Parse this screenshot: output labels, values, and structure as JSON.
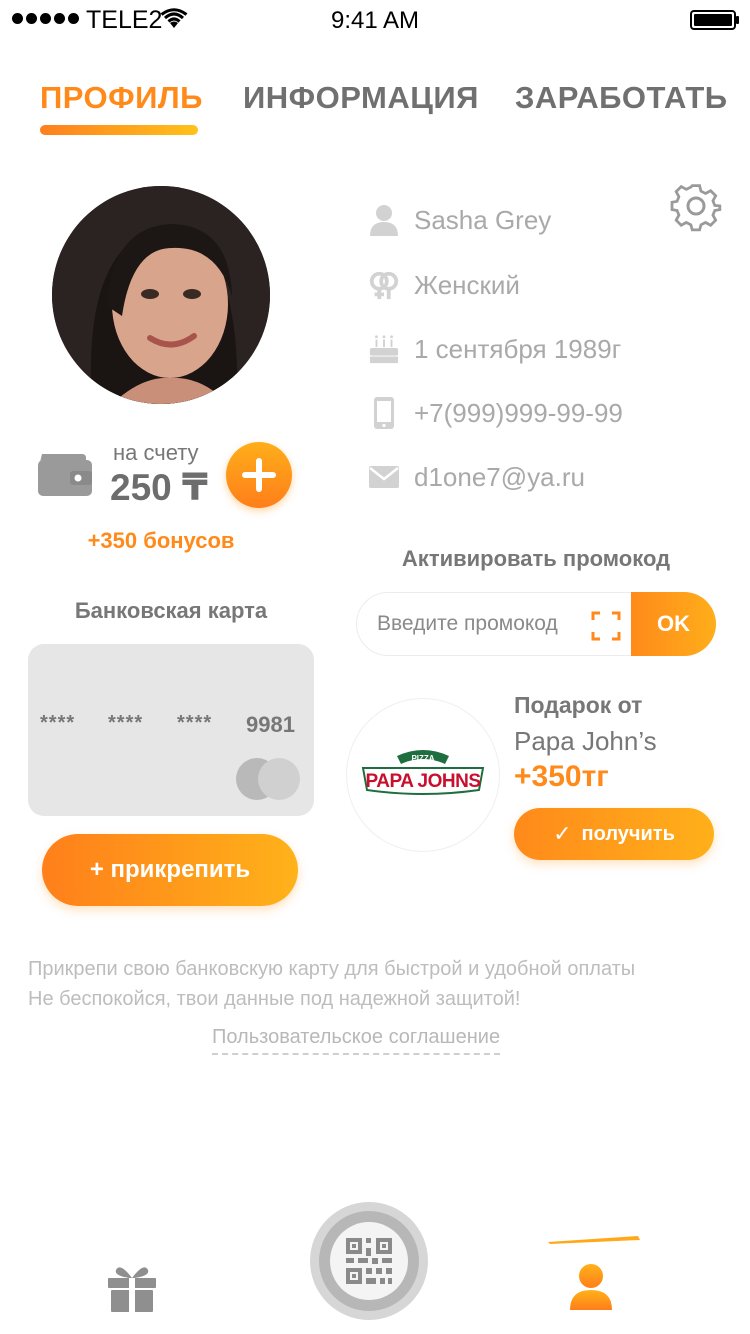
{
  "status_bar": {
    "carrier": "TELE2",
    "time": "9:41 AM"
  },
  "tabs": [
    {
      "label": "ПРОФИЛЬ"
    },
    {
      "label": "ИНФОРМАЦИЯ"
    },
    {
      "label": "ЗАРАБОТАТЬ"
    }
  ],
  "profile": {
    "name": "Sasha Grey",
    "gender": "Женский",
    "birthday": "1 сентября 1989г",
    "phone": "+7(999)999-99-99",
    "email": "d1one7@ya.ru"
  },
  "balance": {
    "label": "на счету",
    "value": "250 ₸",
    "bonus": "+350 бонусов"
  },
  "bank_card": {
    "title": "Банковская карта",
    "masked_groups": [
      "****",
      "****",
      "****"
    ],
    "last4": "9981",
    "attach_label": "+ прикрепить"
  },
  "promo": {
    "title": "Активировать промокод",
    "placeholder": "Введите промокод",
    "ok_label": "OK"
  },
  "gift": {
    "from_label": "Подарок от",
    "partner": "Papa John’s",
    "amount": "+350тг",
    "get_label": "получить",
    "logo_top": "PIZZA",
    "logo_text": "PAPA JOHNS"
  },
  "hint": {
    "line1": "Прикрепи свою банковскую карту для быстрой и удобной оплаты",
    "line2": "Не беспокойся, твои данные под надежной защитой!"
  },
  "agreement_link": "Пользовательское соглашение",
  "colors": {
    "accent": "#ff8a1a",
    "accent_light": "#ffb21a",
    "text_gray": "#777777",
    "muted_gray": "#a9a9a9"
  }
}
